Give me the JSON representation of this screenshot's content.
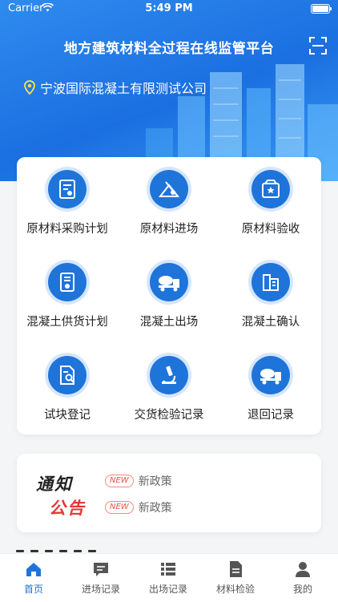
{
  "status_bar": {
    "carrier": "Carrier",
    "time": "5:49 PM"
  },
  "header": {
    "title": "地方建筑材料全过程在线监管平台",
    "company": "宁波国际混凝土有限测试公司"
  },
  "menu": [
    {
      "label": "原材料采购计划",
      "icon": "purchase-plan-icon"
    },
    {
      "label": "原材料进场",
      "icon": "material-entry-icon"
    },
    {
      "label": "原材料验收",
      "icon": "material-acceptance-icon"
    },
    {
      "label": "混凝土供货计划",
      "icon": "supply-plan-icon"
    },
    {
      "label": "混凝土出场",
      "icon": "mixer-truck-icon"
    },
    {
      "label": "混凝土确认",
      "icon": "confirm-icon"
    },
    {
      "label": "试块登记",
      "icon": "test-block-icon"
    },
    {
      "label": "交货检验记录",
      "icon": "microscope-icon"
    },
    {
      "label": "退回记录",
      "icon": "return-truck-icon"
    }
  ],
  "notice": {
    "logo_line1": "通知",
    "logo_line2": "公告",
    "items": [
      {
        "badge": "NEW",
        "text": "新政策"
      },
      {
        "badge": "NEW",
        "text": "新政策"
      }
    ]
  },
  "tabbar": [
    {
      "label": "首页",
      "icon": "home-icon",
      "active": true
    },
    {
      "label": "进场记录",
      "icon": "chat-icon",
      "active": false
    },
    {
      "label": "出场记录",
      "icon": "list-icon",
      "active": false
    },
    {
      "label": "材料检验",
      "icon": "document-icon",
      "active": false
    },
    {
      "label": "我的",
      "icon": "person-icon",
      "active": false
    }
  ],
  "colors": {
    "primary": "#1f74d9",
    "accent_red": "#e53935"
  }
}
